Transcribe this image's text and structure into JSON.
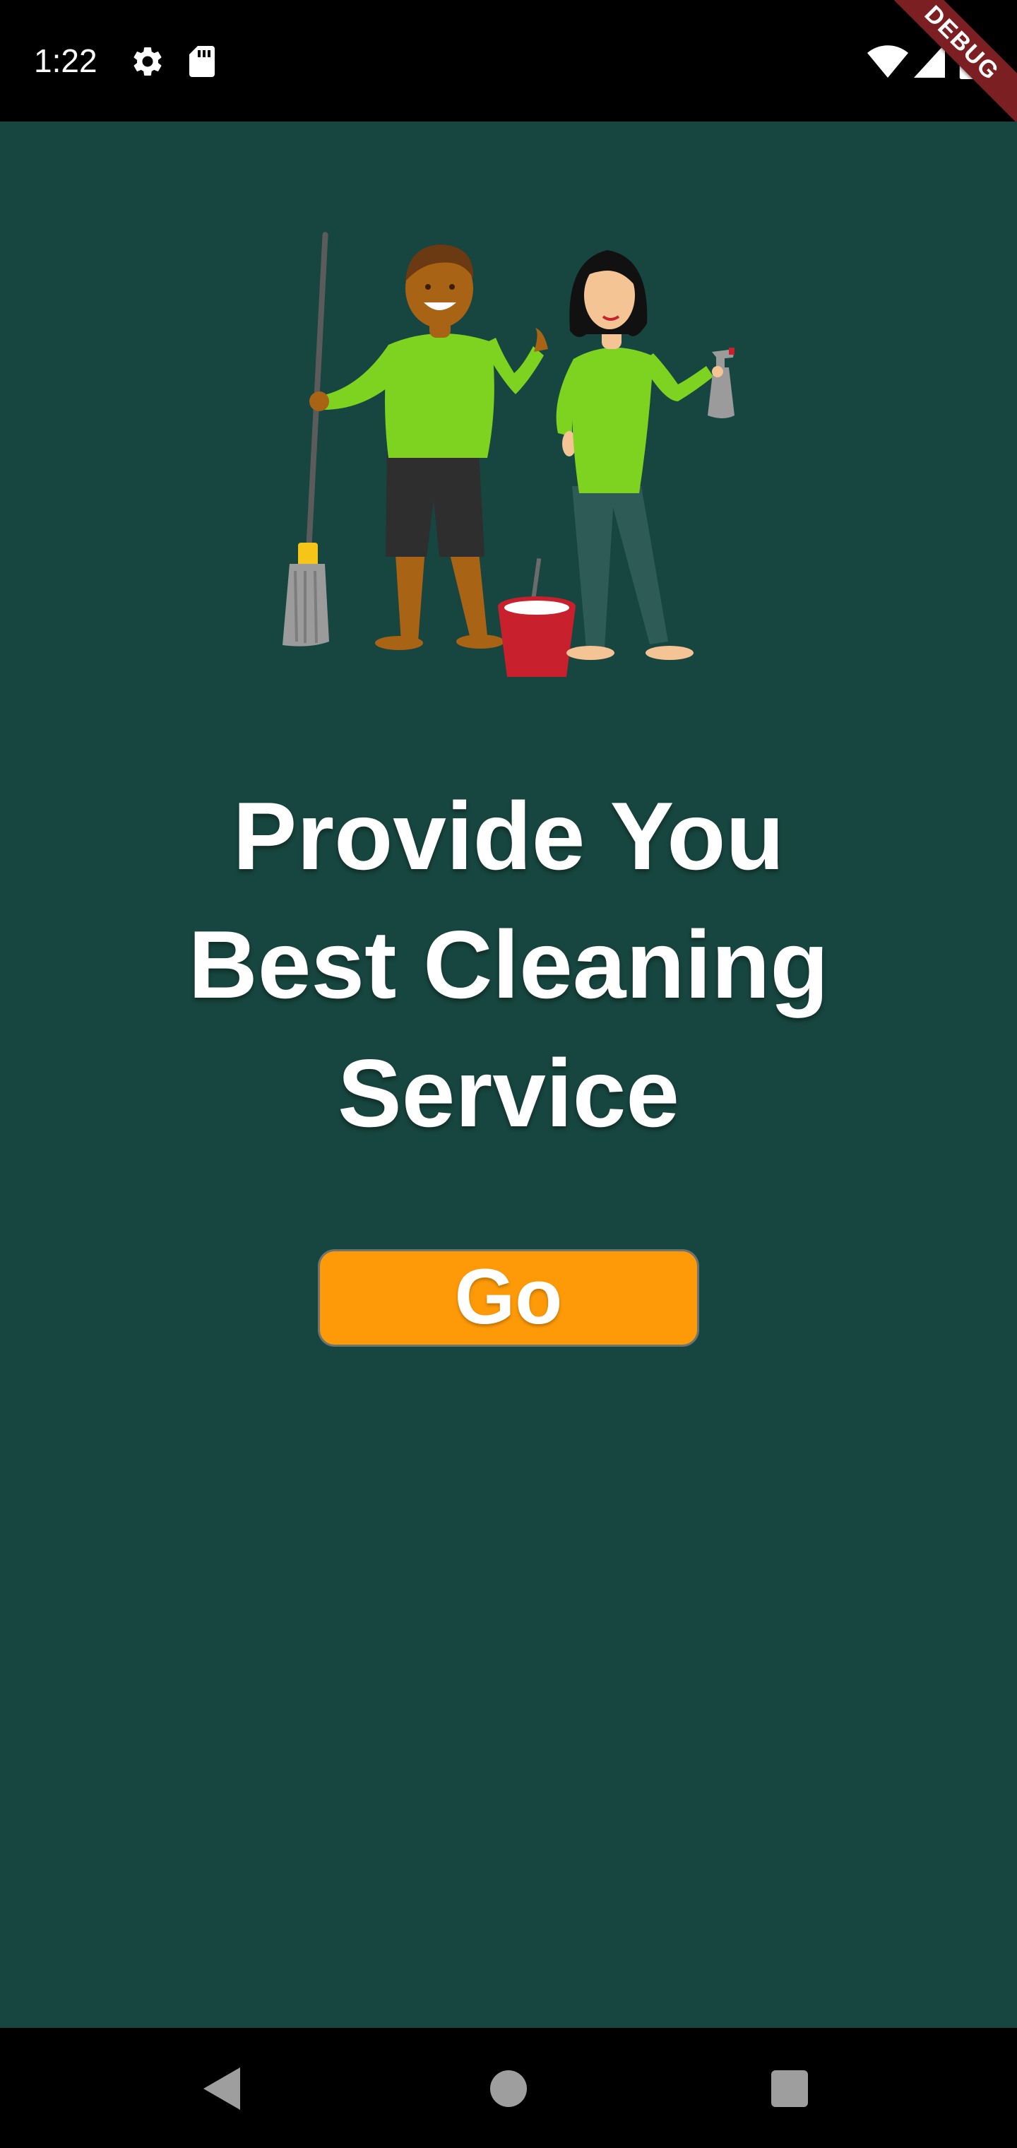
{
  "status_bar": {
    "time": "1:22",
    "icons": [
      "gear-icon",
      "sd-card-icon",
      "wifi-icon",
      "cell-signal-icon",
      "battery-icon"
    ]
  },
  "debug_banner": {
    "label": "DEBUG"
  },
  "illustration": {
    "icon": "cleaning-crew-illustration",
    "colors": {
      "shirt": "#7ed321",
      "bucket": "#c8202c",
      "mop_band": "#f5c518"
    }
  },
  "headline": {
    "lines": [
      "Provide You",
      "Best Cleaning",
      "Service"
    ]
  },
  "go_button": {
    "label": "Go",
    "color": "#fe9a08"
  },
  "theme": {
    "background": "#17453f",
    "text": "#ffffff"
  },
  "nav_bar": {
    "icons": [
      "back-icon",
      "home-icon",
      "recents-icon"
    ]
  }
}
